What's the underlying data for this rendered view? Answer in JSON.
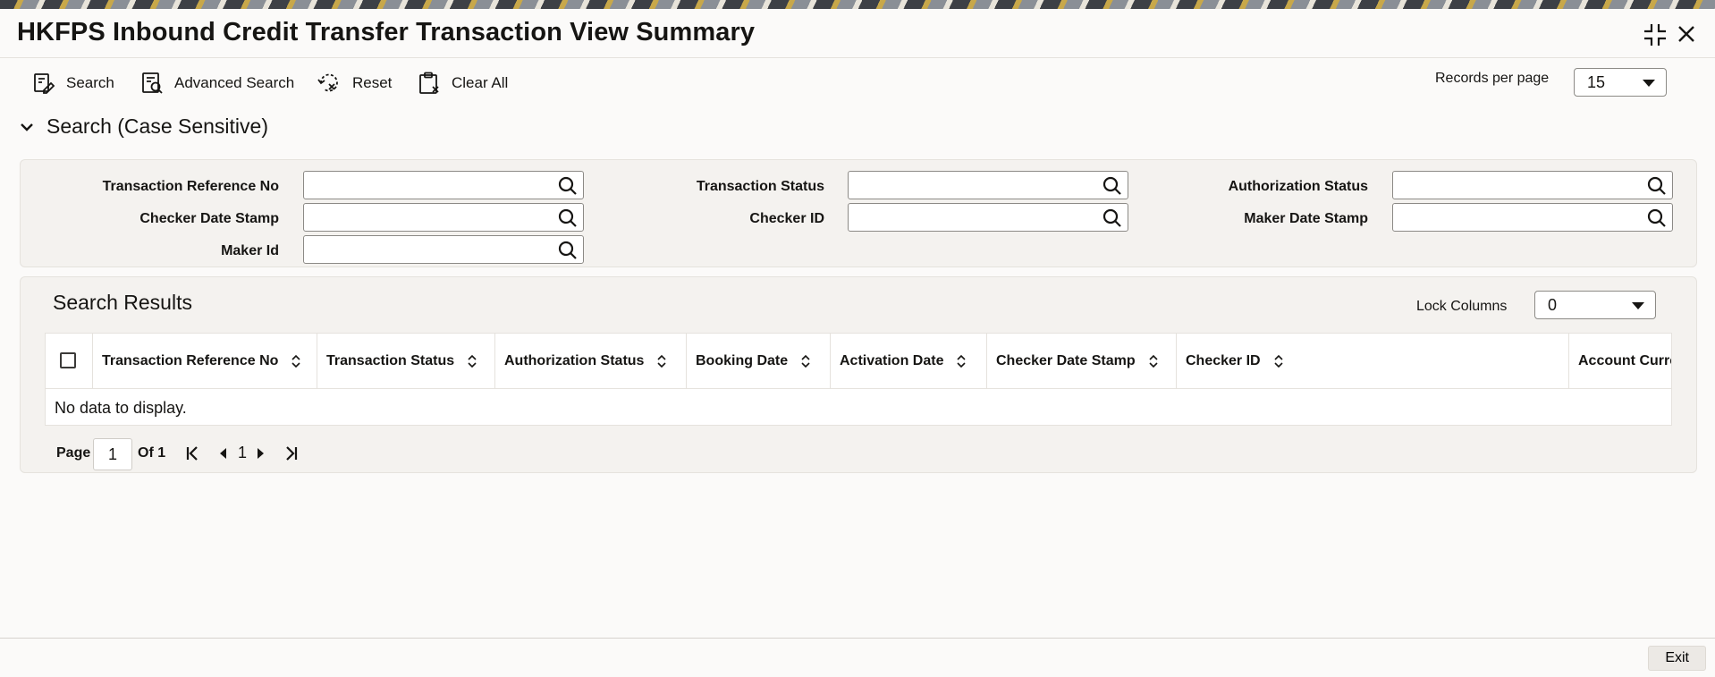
{
  "title": "HKFPS Inbound Credit Transfer Transaction View Summary",
  "toolbar": {
    "search": "Search",
    "advanced_search": "Advanced Search",
    "reset": "Reset",
    "clear_all": "Clear All",
    "records_per_page_label": "Records per page",
    "records_per_page_value": "15"
  },
  "search_section": {
    "title": "Search (Case Sensitive)",
    "fields": {
      "transaction_reference_no": {
        "label": "Transaction Reference No",
        "value": ""
      },
      "transaction_status": {
        "label": "Transaction Status",
        "value": ""
      },
      "authorization_status": {
        "label": "Authorization Status",
        "value": ""
      },
      "checker_date_stamp": {
        "label": "Checker Date Stamp",
        "value": ""
      },
      "checker_id": {
        "label": "Checker ID",
        "value": ""
      },
      "maker_date_stamp": {
        "label": "Maker Date Stamp",
        "value": ""
      },
      "maker_id": {
        "label": "Maker Id",
        "value": ""
      }
    }
  },
  "results": {
    "title": "Search Results",
    "lock_columns_label": "Lock Columns",
    "lock_columns_value": "0",
    "columns": [
      "Transaction Reference No",
      "Transaction Status",
      "Authorization Status",
      "Booking Date",
      "Activation Date",
      "Checker Date Stamp",
      "Checker ID",
      "Account Curre"
    ],
    "empty_message": "No data to display."
  },
  "pagination": {
    "page_label": "Page",
    "current_page": "1",
    "of_label": "Of 1",
    "page_number": "1"
  },
  "footer": {
    "exit": "Exit"
  },
  "colors": {
    "background": "#fbfaf9",
    "panel": "#f4f2ef",
    "text": "#161513",
    "border": "#8c8a86"
  },
  "icons": {
    "search": "search-doc-icon",
    "advanced_search": "advanced-search-icon",
    "reset": "reset-icon",
    "clear_all": "clipboard-clear-icon",
    "lookup": "magnifier-icon",
    "minimize": "compress-icon",
    "close": "close-icon"
  }
}
